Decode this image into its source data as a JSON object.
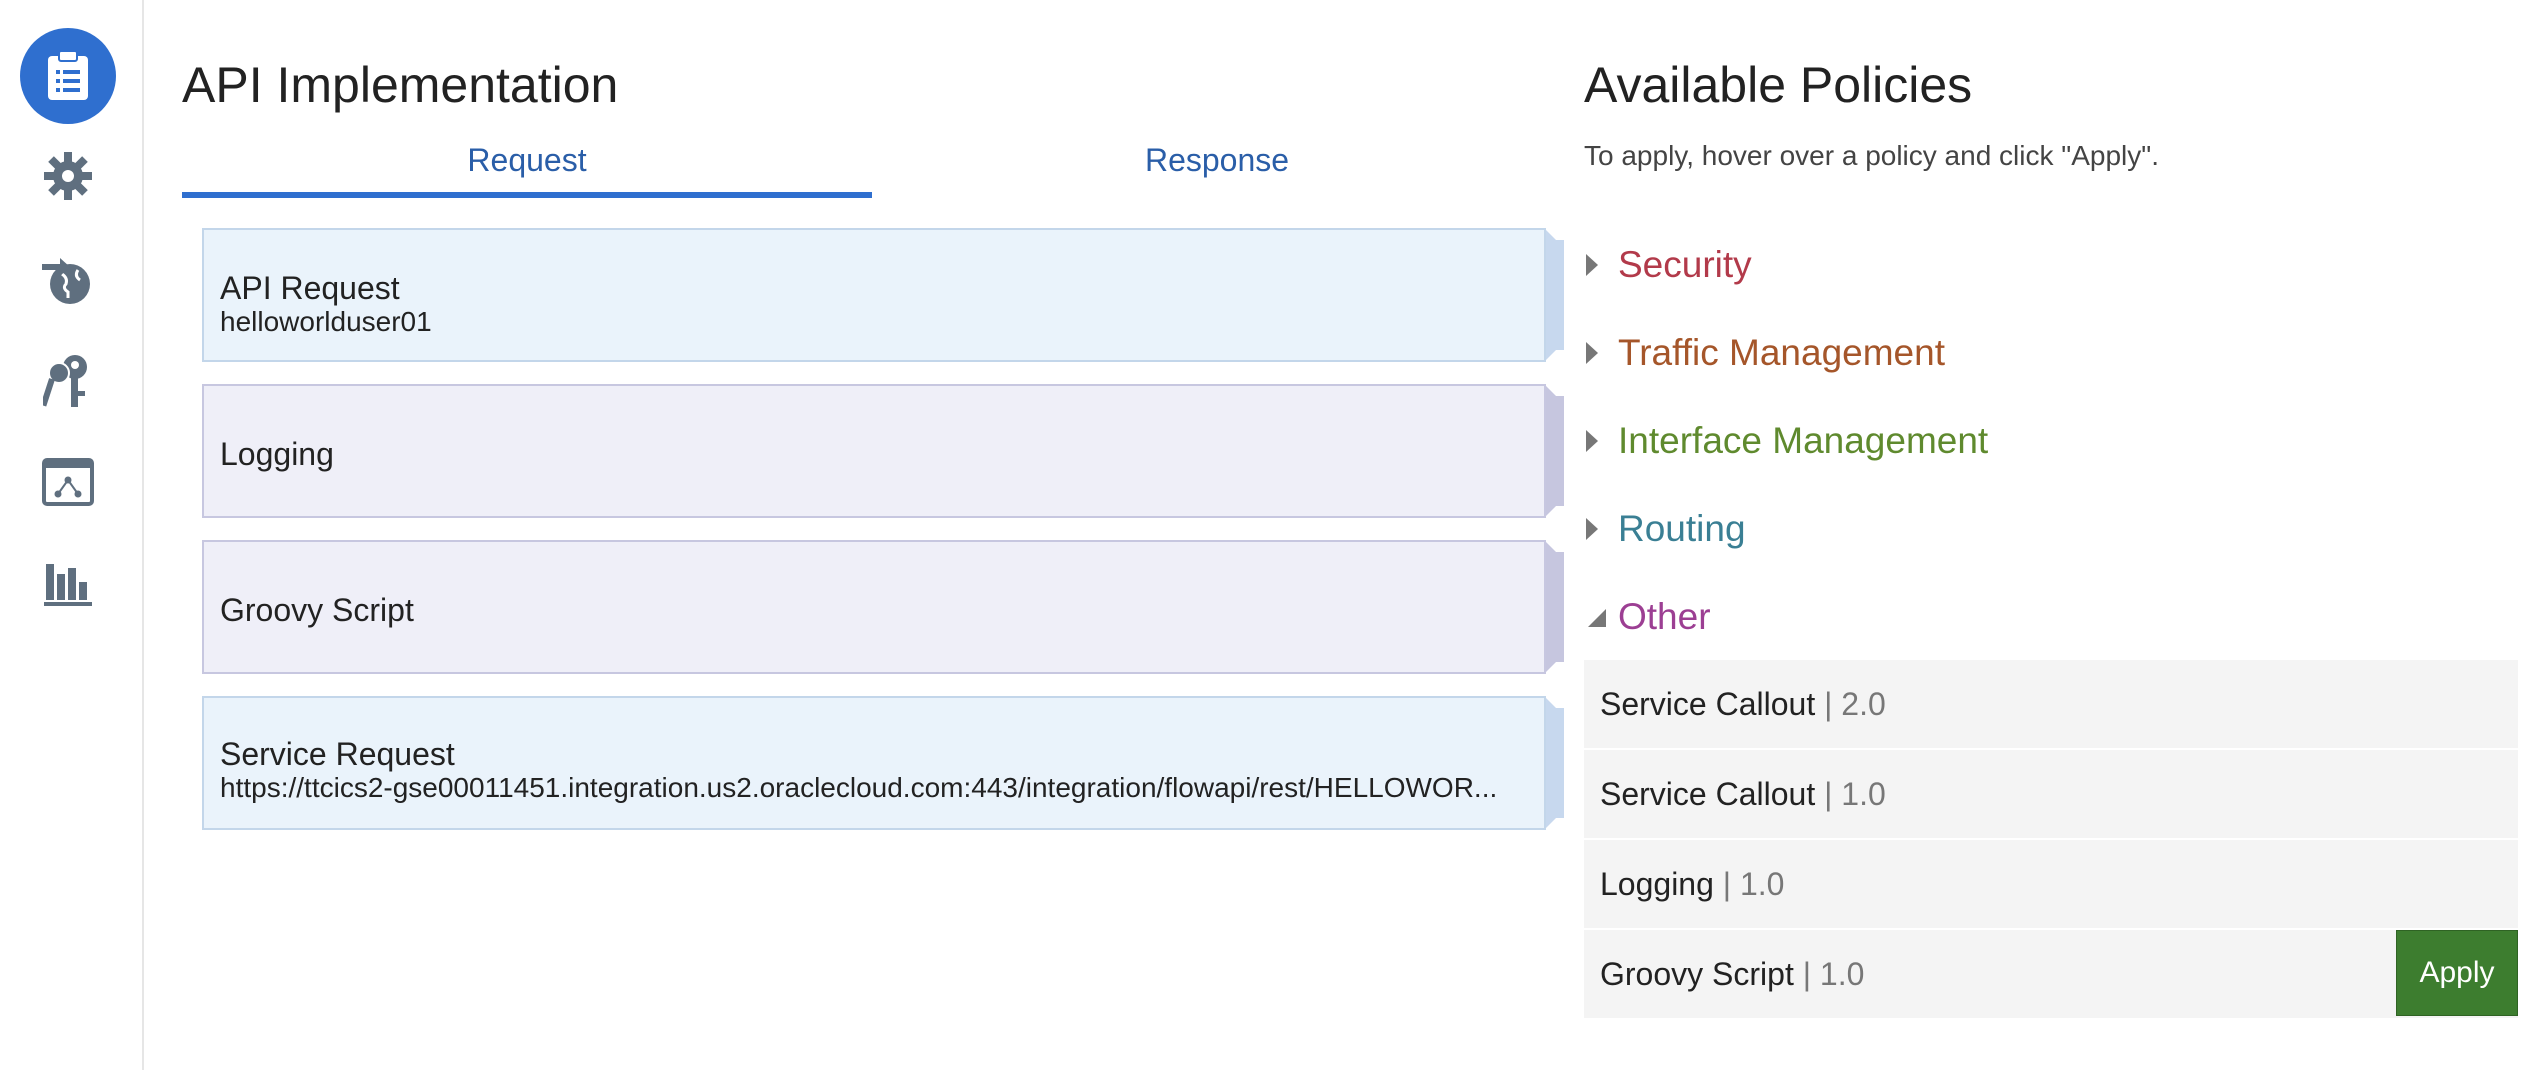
{
  "sidebar": {
    "items": [
      {
        "icon": "clipboard-list-icon",
        "active": true
      },
      {
        "icon": "gear-icon",
        "active": false
      },
      {
        "icon": "globe-deploy-icon",
        "active": false
      },
      {
        "icon": "keys-icon",
        "active": false
      },
      {
        "icon": "app-hierarchy-icon",
        "active": false
      },
      {
        "icon": "bar-chart-icon",
        "active": false
      }
    ],
    "accent": "#2f6fcf",
    "icon_color": "#5f6f7f"
  },
  "main": {
    "title": "API Implementation",
    "tabs": [
      {
        "label": "Request",
        "selected": true
      },
      {
        "label": "Response",
        "selected": false
      }
    ],
    "flow": [
      {
        "title": "API Request",
        "detail": "helloworlduser01"
      },
      {
        "title": "Logging",
        "detail": ""
      },
      {
        "title": "Groovy Script",
        "detail": ""
      },
      {
        "title": "Service Request",
        "detail": "https://ttcics2-gse00011451.integration.us2.oraclecloud.com:443/integration/flowapi/rest/HELLOWOR..."
      }
    ]
  },
  "policies": {
    "title": "Available Policies",
    "subtitle": "To apply, hover over a policy and click \"Apply\".",
    "categories": [
      {
        "label": "Security",
        "color": "#b23a4a",
        "expanded": false
      },
      {
        "label": "Traffic Management",
        "color": "#a5562a",
        "expanded": false
      },
      {
        "label": "Interface Management",
        "color": "#5f8a2e",
        "expanded": false
      },
      {
        "label": "Routing",
        "color": "#3a7f94",
        "expanded": false
      },
      {
        "label": "Other",
        "color": "#9c3f93",
        "expanded": true
      }
    ],
    "other_items": [
      {
        "name": "Service Callout",
        "sep": "|",
        "version": "2.0"
      },
      {
        "name": "Service Callout",
        "sep": "|",
        "version": "1.0"
      },
      {
        "name": "Logging",
        "sep": "|",
        "version": "1.0"
      },
      {
        "name": "Groovy Script",
        "sep": "|",
        "version": "1.0"
      }
    ],
    "apply_label": "Apply",
    "apply_color": "#3d7d2f"
  }
}
